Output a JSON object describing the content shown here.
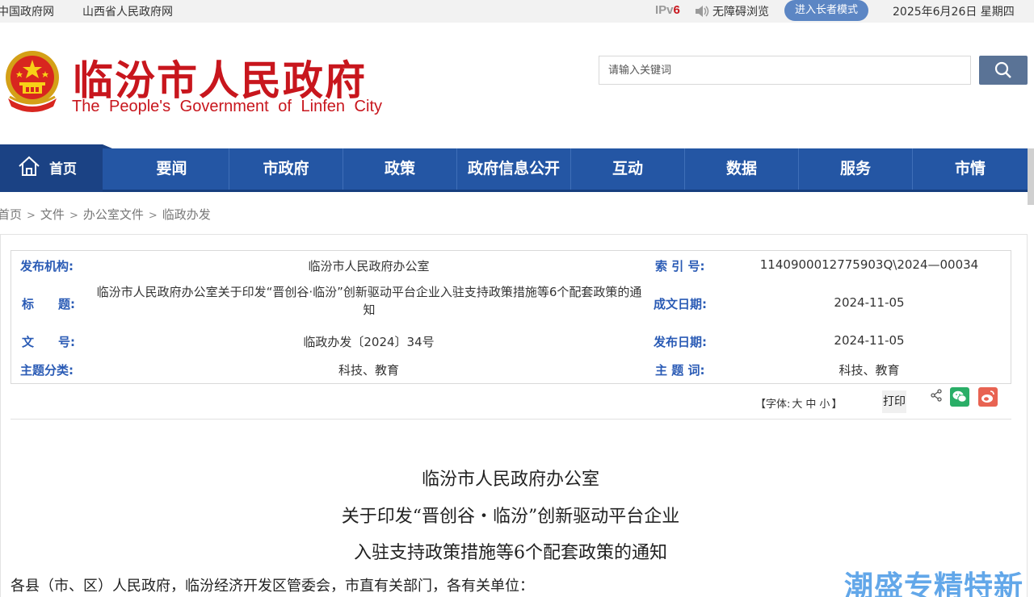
{
  "topbar": {
    "link1": "中国政府网",
    "link2": "山西省人民政府网",
    "ipv6_prefix": "IPv",
    "ipv6_suffix": "6",
    "accessibility": "无障碍浏览",
    "elder_mode": "进入长者模式",
    "date": "2025年6月26日 星期四"
  },
  "header": {
    "title": "临汾市人民政府",
    "subtitle": "The People's Government of Linfen City",
    "search_placeholder": "请输入关键词"
  },
  "nav": {
    "home": "首页",
    "items": [
      "要闻",
      "市政府",
      "政策",
      "政府信息公开",
      "互动",
      "数据",
      "服务",
      "市情"
    ]
  },
  "breadcrumb": [
    "首页",
    "文件",
    "办公室文件",
    "临政办发"
  ],
  "info": {
    "publisher_label": "发布机构:",
    "publisher": "临汾市人民政府办公室",
    "index_label": "索 引 号:",
    "index": "1140900012775903Q\\2024—00034",
    "title_label": "标　　题:",
    "title": "临汾市人民政府办公室关于印发“晋创谷·临汾”创新驱动平台企业入驻支持政策措施等6个配套政策的通知",
    "created_label": "成文日期:",
    "created": "2024-11-05",
    "docno_label": "文　　号:",
    "docno": "临政办发〔2024〕34号",
    "published_label": "发布日期:",
    "published": "2024-11-05",
    "category_label": "主题分类:",
    "category": "科技、教育",
    "keywords_label": "主 题 词:",
    "keywords": "科技、教育"
  },
  "toolbar": {
    "font_prefix": "【字体:",
    "font_large": "大",
    "font_medium": "中",
    "font_small": "小",
    "font_suffix": "】",
    "print": "打印"
  },
  "article": {
    "title_line1": "临汾市人民政府办公室",
    "title_line2": "关于印发“晋创谷・临汾”创新驱动平台企业",
    "title_line3": "入驻支持政策措施等6个配套政策的通知",
    "greeting": "各县（市、区）人民政府，临汾经济开发区管委会，市直有关部门，各有关单位："
  },
  "watermark": "潮盛专精特新",
  "colors": {
    "brand_red": "#c8161d",
    "nav_blue": "#2456a4",
    "label_blue": "#2a5bb5"
  }
}
